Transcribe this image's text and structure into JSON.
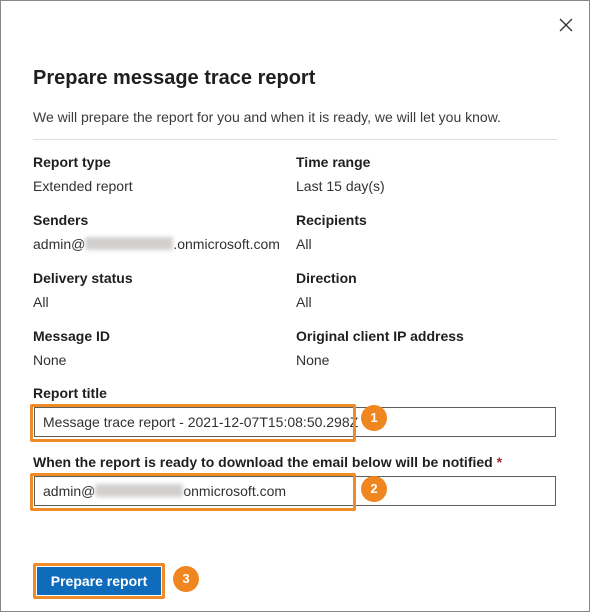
{
  "dialog": {
    "title": "Prepare message trace report",
    "description": "We will prepare the report for you and when it is ready, we will let you know."
  },
  "fields": {
    "report_type": {
      "label": "Report type",
      "value": "Extended report"
    },
    "time_range": {
      "label": "Time range",
      "value": "Last 15 day(s)"
    },
    "senders": {
      "label": "Senders",
      "value_prefix": "admin@",
      "value_suffix": ".onmicrosoft.com"
    },
    "recipients": {
      "label": "Recipients",
      "value": "All"
    },
    "delivery_status": {
      "label": "Delivery status",
      "value": "All"
    },
    "direction": {
      "label": "Direction",
      "value": "All"
    },
    "message_id": {
      "label": "Message ID",
      "value": "None"
    },
    "original_client_ip": {
      "label": "Original client IP address",
      "value": "None"
    }
  },
  "report_title": {
    "label": "Report title",
    "value": "Message trace report - 2021-12-07T15:08:50.298Z"
  },
  "notify_email": {
    "label": "When the report is ready to download the email below will be notified",
    "required_marker": "*",
    "value_prefix": "admin@",
    "value_suffix": "onmicrosoft.com"
  },
  "actions": {
    "prepare_label": "Prepare report"
  },
  "callouts": {
    "one": "1",
    "two": "2",
    "three": "3"
  },
  "icons": {
    "close": "close-icon"
  },
  "colors": {
    "accent": "#0f6cbd",
    "highlight": "#f08c28",
    "badge": "#f0861f"
  }
}
